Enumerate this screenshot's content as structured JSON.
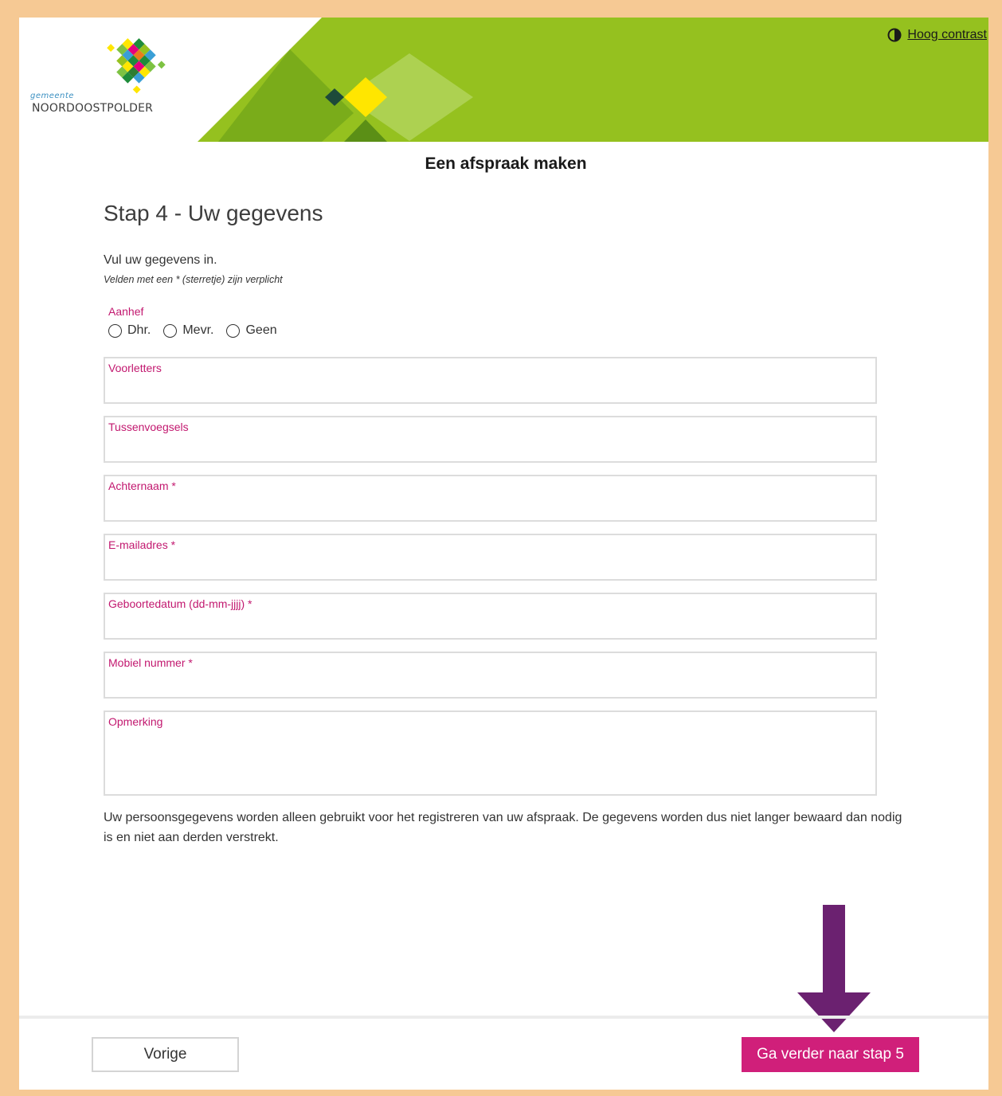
{
  "header": {
    "logo_text_small": "gemeente",
    "logo_text_main": "NOORDOOSTPOLDER",
    "contrast_link": "Hoog contrast",
    "contrast_icon": "half-circle-contrast-icon",
    "colors": {
      "banner_green": "#95c11f",
      "banner_dark": "#5b8f16",
      "accent_yellow": "#ffe600"
    }
  },
  "page": {
    "heading": "Een afspraak maken",
    "step_title": "Stap 4 - Uw gegevens",
    "intro": "Vul uw gegevens in.",
    "required_note": "Velden met een * (sterretje) zijn verplicht"
  },
  "salutation": {
    "label": "Aanhef",
    "options": [
      "Dhr.",
      "Mevr.",
      "Geen"
    ]
  },
  "fields": {
    "initials": {
      "label": "Voorletters",
      "value": ""
    },
    "infix": {
      "label": "Tussenvoegsels",
      "value": ""
    },
    "surname": {
      "label": "Achternaam *",
      "value": ""
    },
    "email": {
      "label": "E-mailadres *",
      "value": ""
    },
    "birthdate": {
      "label": "Geboortedatum (dd-mm-jjjj) *",
      "value": ""
    },
    "mobile": {
      "label": "Mobiel nummer *",
      "value": ""
    },
    "remark": {
      "label": "Opmerking",
      "value": ""
    }
  },
  "privacy_text": "Uw persoonsgegevens worden alleen gebruikt voor het registreren van uw afspraak. De gegevens worden dus niet langer bewaard dan nodig is en niet aan derden verstrekt.",
  "footer": {
    "prev_label": "Vorige",
    "next_label": "Ga verder naar stap 5",
    "colors": {
      "primary": "#d01f7a",
      "label_pink": "#c2186f",
      "annotation_arrow": "#6b2170"
    }
  }
}
